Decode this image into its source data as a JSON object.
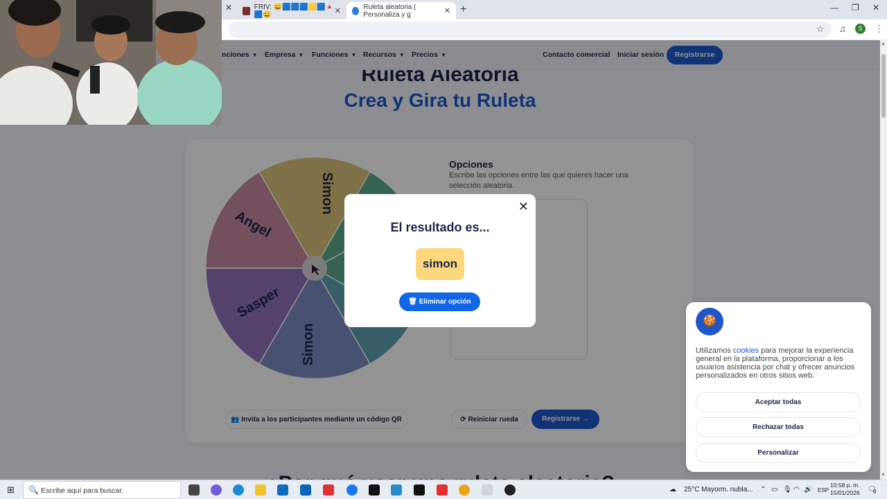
{
  "browser": {
    "tabs": [
      {
        "label": "FRIV: 😀🟦🟦🟦🟨🟦🔺🟦😀",
        "active": false
      },
      {
        "label": "Ruleta aleatoria | Personaliza y g",
        "active": true
      }
    ],
    "new_tab": "+",
    "close_glyph": "✕"
  },
  "nav": {
    "items": [
      "nciones",
      "Empresa",
      "Funciones",
      "Recursos",
      "Precios"
    ],
    "contact": "Contacto comercial",
    "login": "Iniciar sesión",
    "register": "Registrarse"
  },
  "hero": {
    "title": "Ruleta Aleatoria",
    "subtitle": "Crea y Gira tu Ruleta"
  },
  "wheel": {
    "segments": [
      {
        "label": "Simon",
        "color": "#d9c37a"
      },
      {
        "label": "Angel",
        "color": "#c48aa0"
      },
      {
        "label": "Sasper",
        "color": "#8e72ba"
      },
      {
        "label": "Simon",
        "color": "#7c8cc2"
      }
    ],
    "extra_colors": [
      "#5eaa8a",
      "#5fa3b2",
      "#62a88e"
    ]
  },
  "options": {
    "title": "Opciones",
    "description": "Escribe las opciones entre las que quieres hacer una selección aleatoria."
  },
  "actions": {
    "invite": "Invita a los participantes mediante un código QR",
    "reset": "Reiniciar rueda",
    "register": "Registrarse"
  },
  "bottom_heading": "¿Por qué usar una ruleta aleatoria?",
  "modal": {
    "title": "El resultado es...",
    "result": "simon",
    "delete_button": "Eliminar opción"
  },
  "cookie": {
    "text_before": "Utilizamos ",
    "link": "cookies",
    "text_after": " para mejorar la experiencia general en la plataforma, proporcionar a los usuarios asistencia por chat y ofrecer anuncios personalizados en otros sitios web.",
    "accept": "Aceptar todas",
    "reject": "Rechazar todas",
    "customize": "Personalizar"
  },
  "taskbar": {
    "search_placeholder": "Escribe aquí para buscar.",
    "weather": "25°C  Mayorm. nubla...",
    "lang": "ESP",
    "time": "10:58 p. m.",
    "date": "15/01/2026",
    "notif_count": "9"
  },
  "colors": {
    "brand_blue": "#1e56c8",
    "navy": "#1a2547",
    "result_chip": "#fbd87d"
  }
}
